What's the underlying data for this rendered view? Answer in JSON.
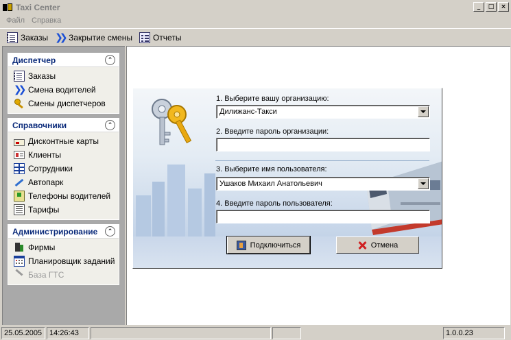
{
  "window": {
    "title": "Taxi Center",
    "controls": {
      "minimize": "_",
      "maximize": "□",
      "close": "×"
    }
  },
  "menu": [
    {
      "label": "Файл"
    },
    {
      "label": "Справка"
    }
  ],
  "toolbar": [
    {
      "label": "Заказы",
      "icon": "orders-icon"
    },
    {
      "label": "Закрытие смены",
      "icon": "double-arrow-icon"
    },
    {
      "label": "Отчеты",
      "icon": "reports-icon"
    }
  ],
  "sidebar": {
    "groups": [
      {
        "title": "Диспетчер",
        "items": [
          {
            "label": "Заказы",
            "icon": "orders-icon"
          },
          {
            "label": "Смена водителей",
            "icon": "double-arrow-icon"
          },
          {
            "label": "Смены диспетчеров",
            "icon": "key-icon"
          }
        ]
      },
      {
        "title": "Справочники",
        "items": [
          {
            "label": "Дисконтные карты",
            "icon": "card-icon"
          },
          {
            "label": "Клиенты",
            "icon": "clients-icon"
          },
          {
            "label": "Сотрудники",
            "icon": "grid-icon"
          },
          {
            "label": "Автопарк",
            "icon": "pencil-icon"
          },
          {
            "label": "Телефоны водителей",
            "icon": "phone-icon"
          },
          {
            "label": "Тарифы",
            "icon": "tariff-icon"
          }
        ]
      },
      {
        "title": "Администрирование",
        "items": [
          {
            "label": "Фирмы",
            "icon": "firm-icon"
          },
          {
            "label": "Планировщик заданий",
            "icon": "scheduler-icon"
          },
          {
            "label": "База ГТС",
            "icon": "database-icon",
            "disabled": true
          }
        ]
      }
    ]
  },
  "login": {
    "org_label": "1. Выберите вашу организацию:",
    "org_value": "Дилижанс-Такси",
    "org_password_label": "2. Введите пароль организации:",
    "org_password_value": "",
    "user_label": "3. Выберите имя пользователя:",
    "user_value": "Ушаков Михаил Анатольевич",
    "user_password_label": "4. Введите пароль пользователя:",
    "user_password_value": "",
    "connect_label": "Подключиться",
    "cancel_label": "Отмена"
  },
  "status": {
    "date": "25.05.2005",
    "time": "14:26:43",
    "panel3": "",
    "panel4": "",
    "version": "1.0.0.23"
  },
  "colors": {
    "window_bg": "#d4d0c8",
    "sidebar_bg": "#a9a9a9",
    "group_header_text": "#0a2a7a",
    "main_bg": "#ffffff"
  }
}
